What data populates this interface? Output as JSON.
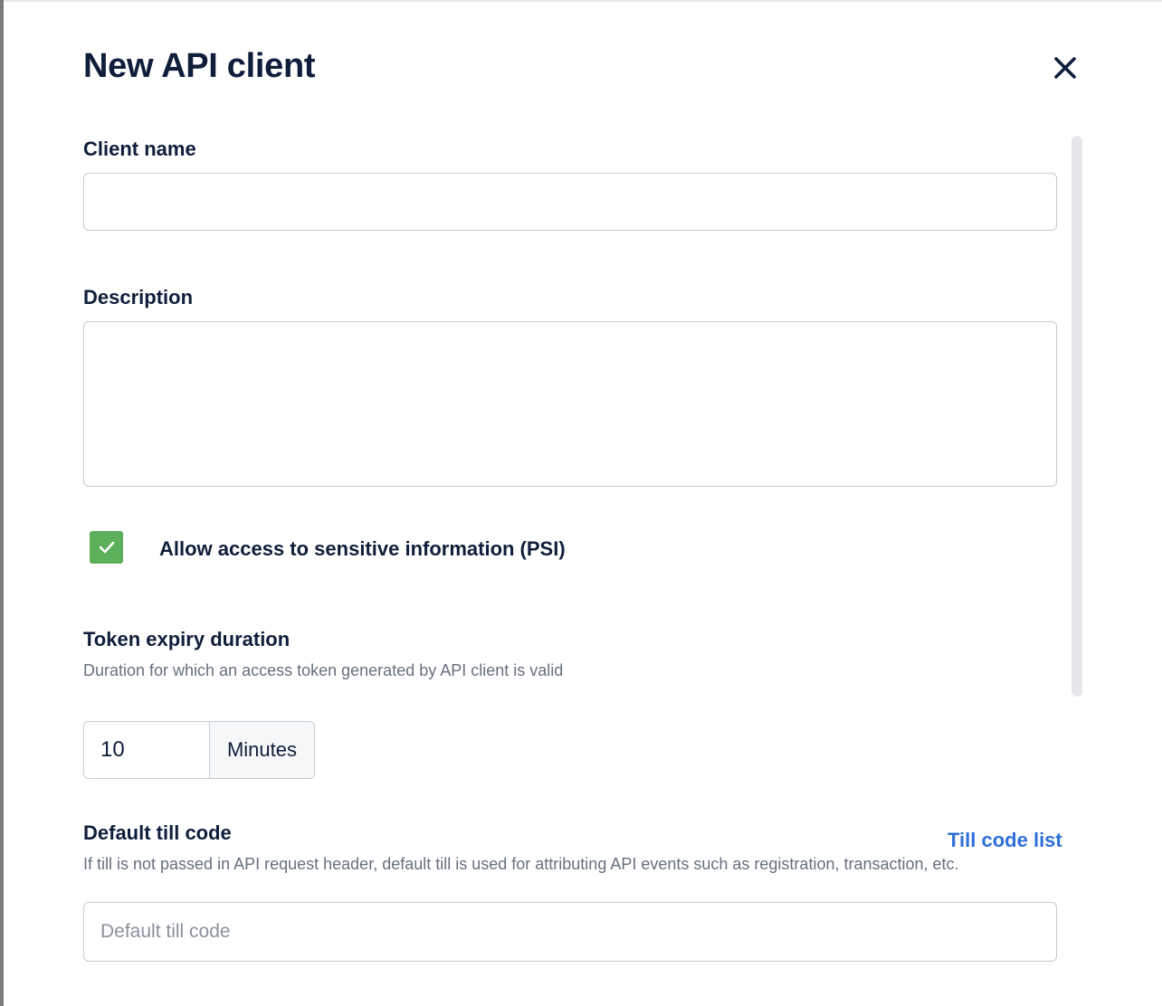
{
  "dialog": {
    "title": "New API client"
  },
  "client_name": {
    "label": "Client name",
    "value": ""
  },
  "description": {
    "label": "Description",
    "value": ""
  },
  "psi": {
    "checked": true,
    "label": "Allow access to sensitive information (PSI)"
  },
  "token_expiry": {
    "label": "Token expiry duration",
    "helper": "Duration for which an access token generated by API client is valid",
    "value": "10",
    "unit": "Minutes"
  },
  "default_till": {
    "label": "Default till code",
    "link": "Till code list",
    "helper": "If till is not passed in API request header, default till is used for attributing API events such as registration, transaction, etc.",
    "value": "",
    "placeholder": "Default till code"
  },
  "colors": {
    "text": "#0f1e3a",
    "helper": "#66707f",
    "checkbox": "#5db05a",
    "link": "#2f6fd8",
    "border": "#c7cbd3"
  },
  "icons": {
    "close": "close-icon",
    "check": "check-icon"
  }
}
